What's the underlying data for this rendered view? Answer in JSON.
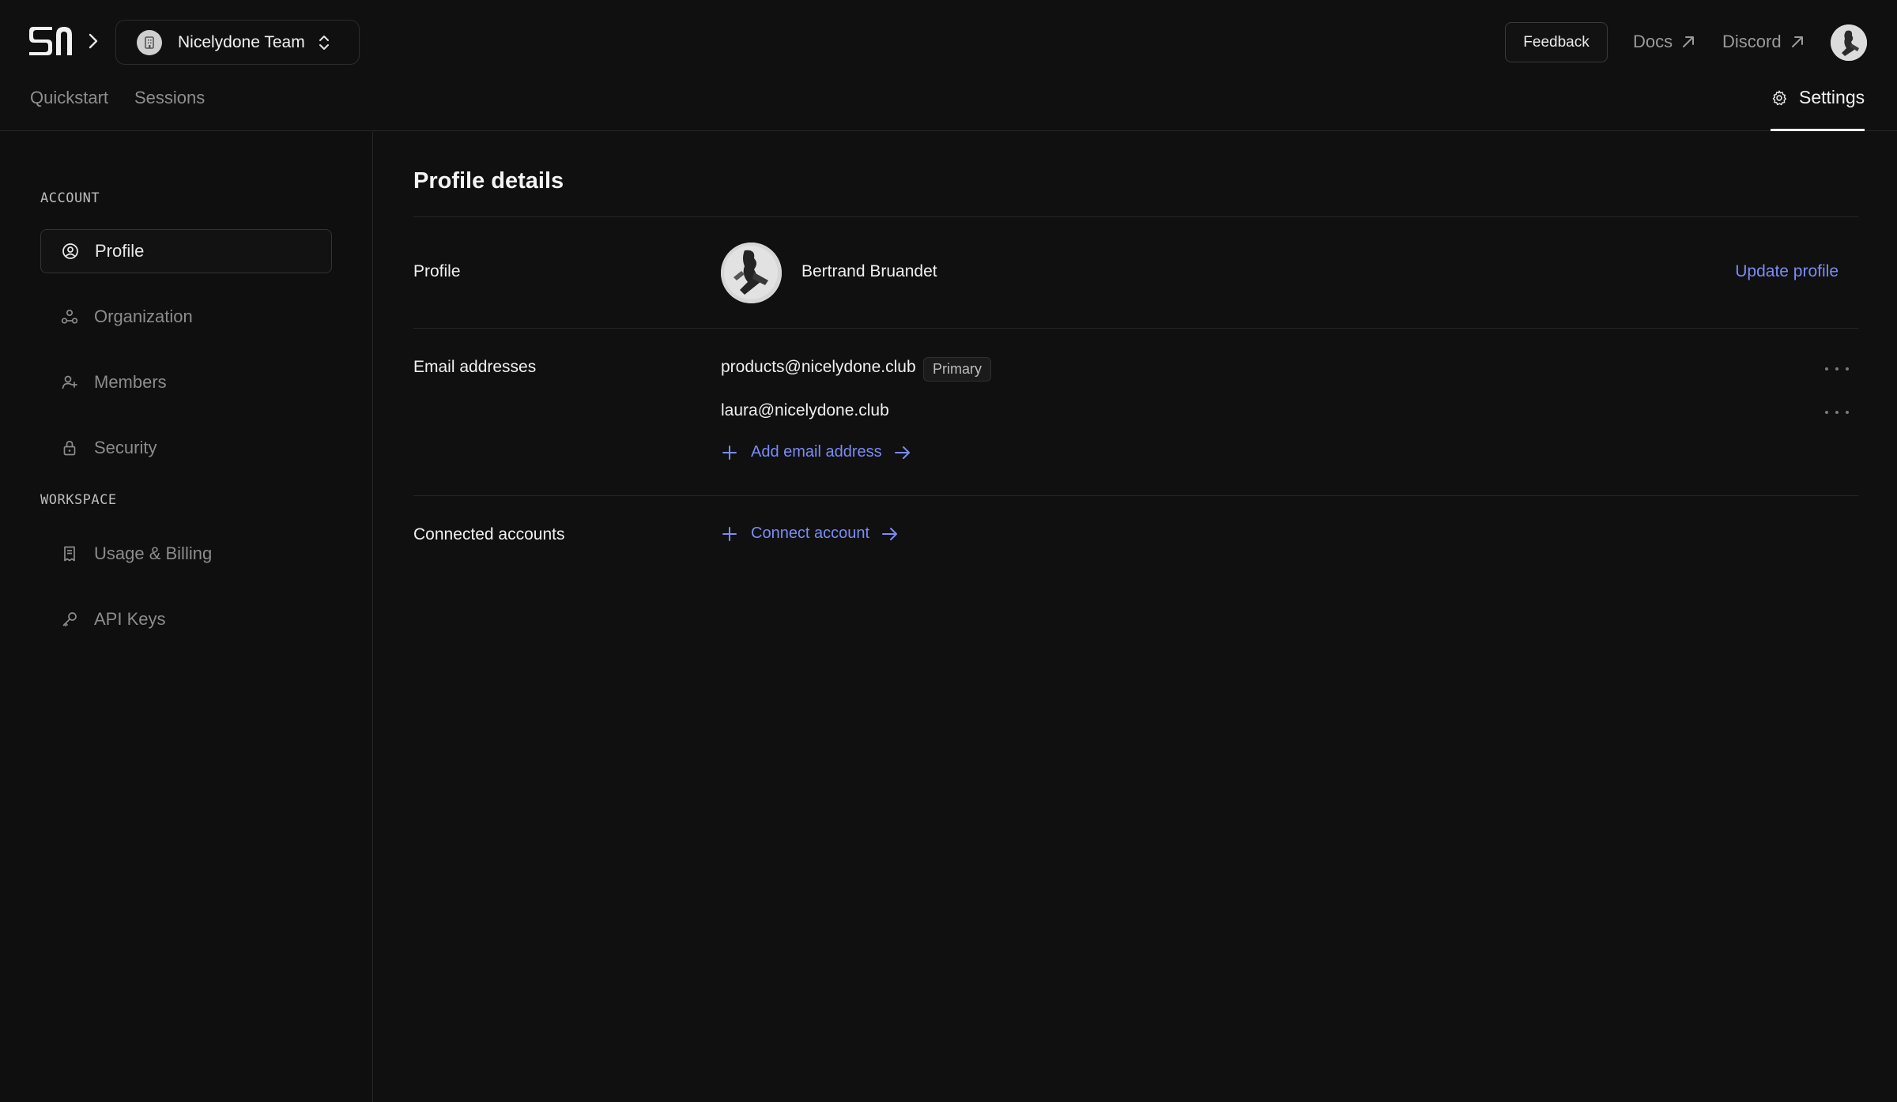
{
  "header": {
    "team_name": "Nicelydone Team",
    "feedback_label": "Feedback",
    "docs_label": "Docs",
    "discord_label": "Discord"
  },
  "nav": {
    "tabs": [
      {
        "label": "Quickstart"
      },
      {
        "label": "Sessions"
      }
    ],
    "settings_label": "Settings"
  },
  "sidebar": {
    "account_label": "ACCOUNT",
    "workspace_label": "WORKSPACE",
    "items": [
      {
        "label": "Profile",
        "icon": "user-circle-icon",
        "active": true
      },
      {
        "label": "Organization",
        "icon": "organization-icon"
      },
      {
        "label": "Members",
        "icon": "user-plus-icon"
      },
      {
        "label": "Security",
        "icon": "lock-icon"
      },
      {
        "label": "Usage & Billing",
        "icon": "receipt-icon"
      },
      {
        "label": "API Keys",
        "icon": "key-icon"
      }
    ]
  },
  "main": {
    "title": "Profile details",
    "profile": {
      "label": "Profile",
      "name": "Bertrand Bruandet",
      "update_label": "Update profile"
    },
    "emails": {
      "label": "Email addresses",
      "items": [
        {
          "address": "products@nicelydone.club",
          "badge": "Primary"
        },
        {
          "address": "laura@nicelydone.club"
        }
      ],
      "add_label": "Add email address"
    },
    "connected": {
      "label": "Connected accounts",
      "connect_label": "Connect account"
    }
  },
  "colors": {
    "background": "#101010",
    "accent_link": "#7a8cf5",
    "border": "#262626"
  }
}
